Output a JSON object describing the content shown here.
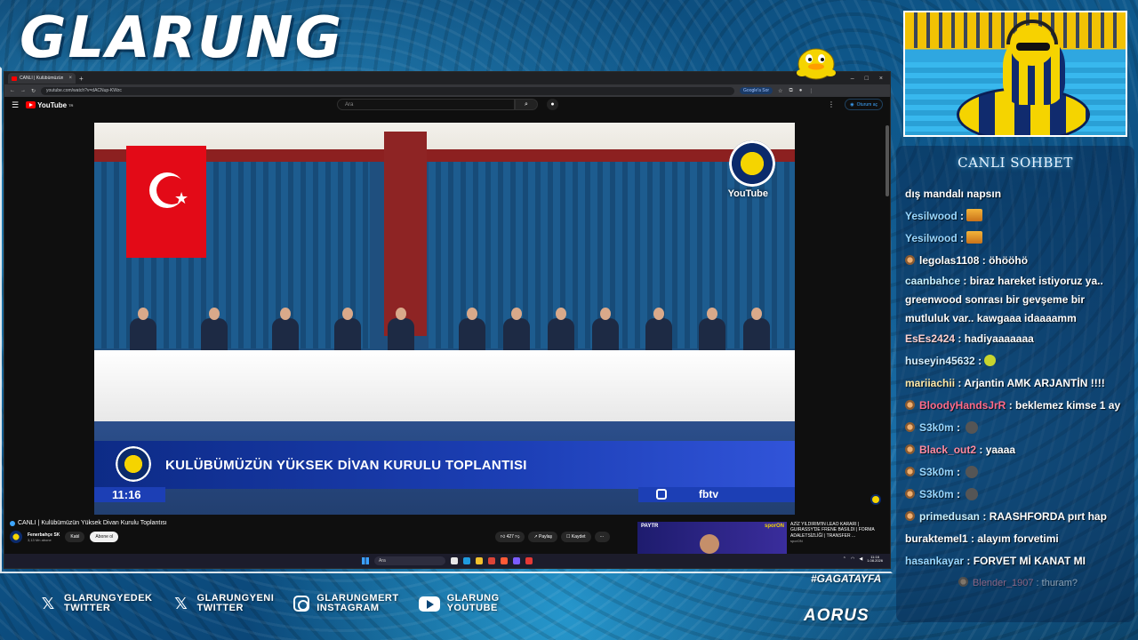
{
  "brand": {
    "title": "GLARUNG"
  },
  "browser": {
    "tab_title": "CANLI | Kulübümüzün",
    "url": "youtube.com/watch?v=dACNup-KWzc",
    "ask_google": "Google'a Sor",
    "window_controls": [
      "–",
      "□",
      "×"
    ]
  },
  "youtube": {
    "logo": "YouTube",
    "country": "TR",
    "search_placeholder": "Ara",
    "signin_label": "Oturum aç",
    "video": {
      "lower_third": "KULÜBÜMÜZÜN YÜKSEK DİVAN KURULU TOPLANTISI",
      "time": "11:16",
      "tv_label": "fbtv",
      "watermark": "YouTube"
    },
    "title": "CANLI | Kulübümüzün Yüksek Divan Kurulu Toplantısı",
    "channel": {
      "name": "Fenerbahçe SK",
      "subs": "3,13 Mn abone"
    },
    "buttons": {
      "join": "Katıl",
      "subscribe": "Abone ol",
      "likes": "427",
      "share": "Paylaş",
      "save": "Kaydet"
    },
    "recommended": {
      "thumb_label": "PAYTR",
      "thumb_brand": "sporON",
      "title": "AZİZ YILDIRIM'IN LEAO KARARI | GUIRASSY'DE FRENE BASILDI | FORMA ADALETSİZLİĞİ | TRANSFER ...",
      "channel": "sporON"
    }
  },
  "taskbar": {
    "search_placeholder": "Ara",
    "time": "11:16",
    "date": "1.08.2026"
  },
  "chat": {
    "title": "CANLI SOHBET",
    "messages": [
      {
        "user": "",
        "user_color": "#ffffff",
        "text": "dış mandalı napsın",
        "badge": false,
        "emote": ""
      },
      {
        "user": "Yesilwood",
        "user_color": "#9ad8ff",
        "text": ":",
        "badge": false,
        "emote": "box"
      },
      {
        "user": "Yesilwood",
        "user_color": "#9ad8ff",
        "text": ":",
        "badge": false,
        "emote": "box"
      },
      {
        "user": "legolas1108",
        "user_color": "#ffffff",
        "text": ": öhööhö",
        "badge": true,
        "emote": ""
      },
      {
        "user": "caanbahce",
        "user_color": "#c7f0ff",
        "text": ": biraz hareket istiyoruz ya.. greenwood sonrası bir gevşeme bir mutluluk var.. kawgaaa idaaaamm",
        "badge": false,
        "emote": ""
      },
      {
        "user": "EsEs2424",
        "user_color": "#ffd2d2",
        "text": ": hadiyaaaaaaa",
        "badge": false,
        "emote": ""
      },
      {
        "user": "huseyin45632",
        "user_color": "#d6f0ff",
        "text": ":",
        "badge": false,
        "emote": "smile"
      },
      {
        "user": "mariiachii",
        "user_color": "#ffe9a8",
        "text": ": Arjantin AMK ARJANTİN !!!!",
        "badge": false,
        "emote": ""
      },
      {
        "user": "BloodyHandsJrR",
        "user_color": "#ff6b8a",
        "text": ": beklemez kimse 1 ay",
        "badge": true,
        "emote": ""
      },
      {
        "user": "S3k0m",
        "user_color": "#9ad8ff",
        "text": ":",
        "badge": true,
        "emote": "skull"
      },
      {
        "user": "Black_out2",
        "user_color": "#ff8aa0",
        "text": ": yaaaa",
        "badge": true,
        "emote": ""
      },
      {
        "user": "S3k0m",
        "user_color": "#9ad8ff",
        "text": ":",
        "badge": true,
        "emote": "skull"
      },
      {
        "user": "S3k0m",
        "user_color": "#9ad8ff",
        "text": ":",
        "badge": true,
        "emote": "skull"
      },
      {
        "user": "primedusan",
        "user_color": "#c7f0ff",
        "text": ": RAASHFORDA pırt hap",
        "badge": true,
        "emote": ""
      },
      {
        "user": "buraktemel1",
        "user_color": "#ffffff",
        "text": ": alayım forvetimi",
        "badge": false,
        "emote": ""
      },
      {
        "user": "hasankayar",
        "user_color": "#9ad8ff",
        "text": ": FORVET Mİ KANAT MI",
        "badge": false,
        "emote": ""
      },
      {
        "user": "Blender_1907",
        "user_color": "#ff8aa0",
        "text": ": thuram?",
        "badge": true,
        "emote": "",
        "faded": true
      }
    ]
  },
  "socials": [
    {
      "icon": "x-icon",
      "line1": "GLARUNGYEDEK",
      "line2": "TWITTER"
    },
    {
      "icon": "x-icon",
      "line1": "GLARUNGYENI",
      "line2": "TWITTER"
    },
    {
      "icon": "instagram-icon",
      "line1": "GLARUNGMERT",
      "line2": "INSTAGRAM"
    },
    {
      "icon": "youtube-icon",
      "line1": "GLARUNG",
      "line2": "YOUTUBE"
    }
  ],
  "hashtag": "#GAGATAYFA",
  "sponsor": "AORUS"
}
